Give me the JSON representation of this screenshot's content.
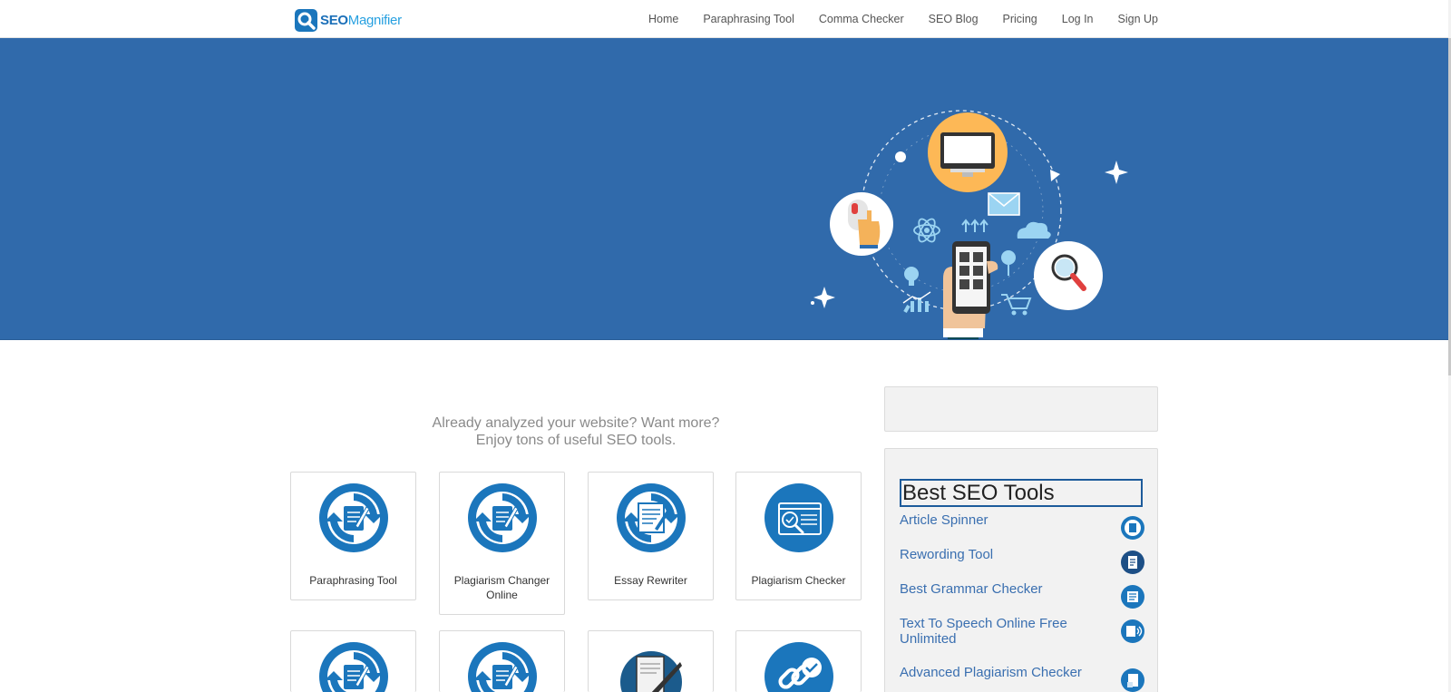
{
  "header": {
    "logo_text_bold": "SEO",
    "logo_text_light": "Magnifier",
    "nav": [
      {
        "label": "Home"
      },
      {
        "label": "Paraphrasing Tool"
      },
      {
        "label": "Comma Checker"
      },
      {
        "label": "SEO Blog"
      },
      {
        "label": "Pricing"
      },
      {
        "label": "Log In"
      },
      {
        "label": "Sign Up"
      }
    ]
  },
  "hero": {
    "illustration": "digital-marketing-illustration",
    "background_color": "#306aab"
  },
  "main": {
    "intro_line1": "Already analyzed your website? Want more?",
    "intro_line2": "Enjoy tons of useful SEO tools.",
    "tools": [
      {
        "label": "Paraphrasing Tool",
        "icon": "paraphrase-icon"
      },
      {
        "label": "Plagiarism Changer Online",
        "icon": "paraphrase-icon"
      },
      {
        "label": "Essay Rewriter",
        "icon": "document-rewrite-icon"
      },
      {
        "label": "Plagiarism Checker",
        "icon": "magnifier-browser-icon"
      },
      {
        "label": "",
        "icon": "paraphrase-icon"
      },
      {
        "label": "",
        "icon": "paraphrase-icon"
      },
      {
        "label": "",
        "icon": "quill-scroll-icon"
      },
      {
        "label": "",
        "icon": "link-check-icon"
      }
    ]
  },
  "sidebar": {
    "title": "Best SEO Tools",
    "items": [
      {
        "label": "Article Spinner",
        "icon": "article-spinner-icon"
      },
      {
        "label": "Rewording Tool",
        "icon": "rewording-icon"
      },
      {
        "label": "Best Grammar Checker",
        "icon": "grammar-checker-icon"
      },
      {
        "label": "Text To Speech Online Free Unlimited",
        "icon": "text-to-speech-icon"
      },
      {
        "label": "Advanced Plagiarism Checker",
        "icon": "plagiarism-doc-icon"
      }
    ]
  },
  "colors": {
    "brand_blue": "#1b76bc",
    "link_blue": "#3a6fb0",
    "hero_blue": "#306aab",
    "accent_yellow": "#fdb856"
  }
}
